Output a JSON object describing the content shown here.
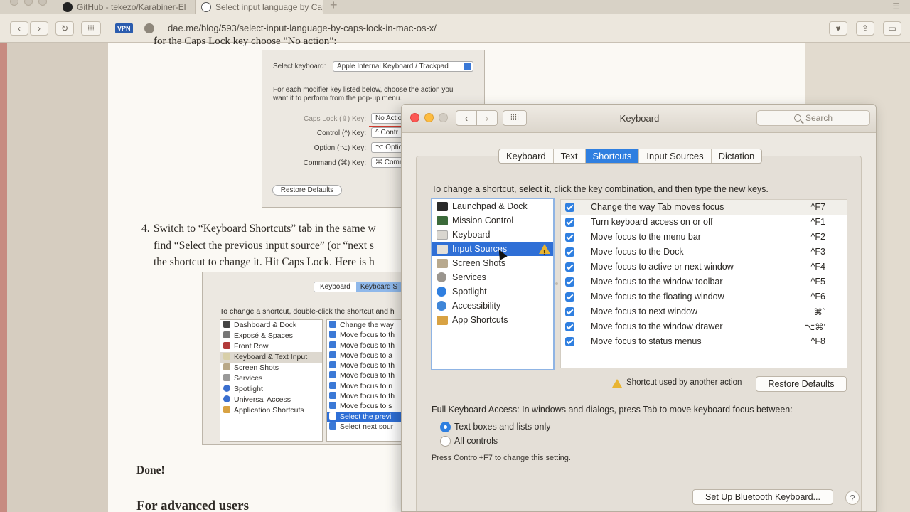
{
  "browser": {
    "tabs": [
      {
        "label": "GitHub - tekezo/Karabiner-El"
      },
      {
        "label": "Select input language by Cap"
      }
    ],
    "new_tab": "+",
    "vpn_badge": "VPN",
    "url": "dae.me/blog/593/select-input-language-by-caps-lock-in-mac-os-x/"
  },
  "article": {
    "top_line": "for the Caps Lock key choose \"No action\":",
    "step4_num": "4.",
    "step4_lines": [
      "Switch to “Keyboard Shortcuts” tab in the same w",
      "find “Select the previous input source” (or “next s",
      "the shortcut to change it. Hit Caps Lock. Here is h"
    ],
    "done": "Done!",
    "advanced": "For advanced users"
  },
  "screenshot1": {
    "select_keyboard_label": "Select keyboard:",
    "select_keyboard_value": "Apple Internal Keyboard / Trackpad",
    "desc_line1": "For each modifier key listed below, choose the action you",
    "desc_line2": "want it to perform from the pop-up menu.",
    "rows": [
      {
        "label": "Caps Lock (⇪) Key:",
        "value": "No Actio"
      },
      {
        "label": "Control (^) Key:",
        "value": "^ Contr"
      },
      {
        "label": "Option (⌥) Key:",
        "value": "⌥ Optio"
      },
      {
        "label": "Command (⌘) Key:",
        "value": "⌘ Comm"
      }
    ],
    "restore": "Restore Defaults"
  },
  "screenshot2": {
    "tab1": "Keyboard",
    "tab2": "Keyboard S",
    "instruction": "To change a shortcut, double-click the shortcut and h",
    "categories": [
      "Dashboard & Dock",
      "Exposé & Spaces",
      "Front Row",
      "Keyboard & Text Input",
      "Screen Shots",
      "Services",
      "Spotlight",
      "Universal Access",
      "Application Shortcuts"
    ],
    "rows": [
      "Change the way",
      "Move focus to th",
      "Move focus to th",
      "Move focus to a",
      "Move focus to th",
      "Move focus to th",
      "Move focus to n",
      "Move focus to th",
      "Move focus to s",
      "Select the previ",
      "Select next sour"
    ]
  },
  "prefs": {
    "title": "Keyboard",
    "search_placeholder": "Search",
    "tabs": [
      "Keyboard",
      "Text",
      "Shortcuts",
      "Input Sources",
      "Dictation"
    ],
    "active_tab": "Shortcuts",
    "instruction": "To change a shortcut, select it, click the key combination, and then type the new keys.",
    "categories": [
      {
        "label": "Launchpad & Dock",
        "icon": "launchpad-icon",
        "color": "#2a2a2a"
      },
      {
        "label": "Mission Control",
        "icon": "mission-control-icon",
        "color": "#3b6a3a"
      },
      {
        "label": "Keyboard",
        "icon": "keyboard-icon",
        "color": "#d9d6d0"
      },
      {
        "label": "Input Sources",
        "icon": "input-sources-icon",
        "color": "#e3dfd8"
      },
      {
        "label": "Screen Shots",
        "icon": "screenshot-icon",
        "color": "#b8a98e"
      },
      {
        "label": "Services",
        "icon": "gear-icon",
        "color": "#9a958e"
      },
      {
        "label": "Spotlight",
        "icon": "spotlight-icon",
        "color": "#2f7fe0"
      },
      {
        "label": "Accessibility",
        "icon": "accessibility-icon",
        "color": "#3f86d8"
      },
      {
        "label": "App Shortcuts",
        "icon": "app-shortcuts-icon",
        "color": "#d8a243"
      }
    ],
    "selected_category": "Input Sources",
    "shortcuts": [
      {
        "name": "Change the way Tab moves focus",
        "key": "^F7"
      },
      {
        "name": "Turn keyboard access on or off",
        "key": "^F1"
      },
      {
        "name": "Move focus to the menu bar",
        "key": "^F2"
      },
      {
        "name": "Move focus to the Dock",
        "key": "^F3"
      },
      {
        "name": "Move focus to active or next window",
        "key": "^F4"
      },
      {
        "name": "Move focus to the window toolbar",
        "key": "^F5"
      },
      {
        "name": "Move focus to the floating window",
        "key": "^F6"
      },
      {
        "name": "Move focus to next window",
        "key": "⌘`"
      },
      {
        "name": "Move focus to the window drawer",
        "key": "⌥⌘'"
      },
      {
        "name": "Move focus to status menus",
        "key": "^F8"
      }
    ],
    "legend": "Shortcut used by another action",
    "restore_defaults": "Restore Defaults",
    "fka_label": "Full Keyboard Access: In windows and dialogs, press Tab to move keyboard focus between:",
    "radio_options": [
      "Text boxes and lists only",
      "All controls"
    ],
    "radio_selected": "Text boxes and lists only",
    "hint": "Press Control+F7 to change this setting.",
    "bluetooth_button": "Set Up Bluetooth Keyboard...",
    "help": "?"
  },
  "colors": {
    "accent": "#2f7fe0",
    "selection": "#2f6fd6",
    "warning": "#e8b431",
    "close": "#fc5753",
    "minimize": "#fdbc40",
    "zoom_disabled": "#d2ccc2"
  }
}
